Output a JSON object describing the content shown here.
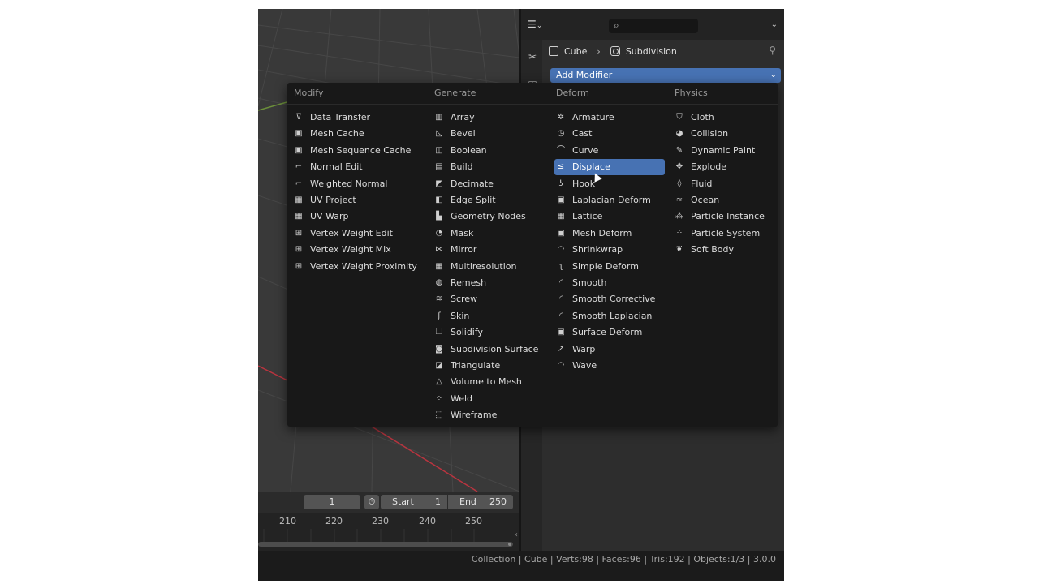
{
  "breadcrumb": {
    "object": "Cube",
    "modifier": "Subdivision"
  },
  "add_modifier": {
    "label": "Add Modifier"
  },
  "menu": {
    "columns": [
      {
        "title": "Modify",
        "items": [
          {
            "label": "Data Transfer",
            "icon": "data-transfer-icon",
            "glyph": "⊽"
          },
          {
            "label": "Mesh Cache",
            "icon": "mesh-cache-icon",
            "glyph": "▣"
          },
          {
            "label": "Mesh Sequence Cache",
            "icon": "mesh-sequence-cache-icon",
            "glyph": "▣"
          },
          {
            "label": "Normal Edit",
            "icon": "normal-edit-icon",
            "glyph": "⌐"
          },
          {
            "label": "Weighted Normal",
            "icon": "weighted-normal-icon",
            "glyph": "⌐"
          },
          {
            "label": "UV Project",
            "icon": "uv-project-icon",
            "glyph": "▦"
          },
          {
            "label": "UV Warp",
            "icon": "uv-warp-icon",
            "glyph": "▦"
          },
          {
            "label": "Vertex Weight Edit",
            "icon": "vertex-weight-edit-icon",
            "glyph": "⊞"
          },
          {
            "label": "Vertex Weight Mix",
            "icon": "vertex-weight-mix-icon",
            "glyph": "⊞"
          },
          {
            "label": "Vertex Weight Proximity",
            "icon": "vertex-weight-proximity-icon",
            "glyph": "⊞"
          }
        ]
      },
      {
        "title": "Generate",
        "items": [
          {
            "label": "Array",
            "icon": "array-icon",
            "glyph": "▥"
          },
          {
            "label": "Bevel",
            "icon": "bevel-icon",
            "glyph": "◺"
          },
          {
            "label": "Boolean",
            "icon": "boolean-icon",
            "glyph": "◫"
          },
          {
            "label": "Build",
            "icon": "build-icon",
            "glyph": "▤"
          },
          {
            "label": "Decimate",
            "icon": "decimate-icon",
            "glyph": "◩"
          },
          {
            "label": "Edge Split",
            "icon": "edge-split-icon",
            "glyph": "◧"
          },
          {
            "label": "Geometry Nodes",
            "icon": "geometry-nodes-icon",
            "glyph": "▙"
          },
          {
            "label": "Mask",
            "icon": "mask-icon",
            "glyph": "◔"
          },
          {
            "label": "Mirror",
            "icon": "mirror-icon",
            "glyph": "⋈"
          },
          {
            "label": "Multiresolution",
            "icon": "multiresolution-icon",
            "glyph": "▦"
          },
          {
            "label": "Remesh",
            "icon": "remesh-icon",
            "glyph": "◍"
          },
          {
            "label": "Screw",
            "icon": "screw-icon",
            "glyph": "≋"
          },
          {
            "label": "Skin",
            "icon": "skin-icon",
            "glyph": "ʃ"
          },
          {
            "label": "Solidify",
            "icon": "solidify-icon",
            "glyph": "❒"
          },
          {
            "label": "Subdivision Surface",
            "icon": "subdivision-surface-icon",
            "glyph": "◙"
          },
          {
            "label": "Triangulate",
            "icon": "triangulate-icon",
            "glyph": "◪"
          },
          {
            "label": "Volume to Mesh",
            "icon": "volume-to-mesh-icon",
            "glyph": "△"
          },
          {
            "label": "Weld",
            "icon": "weld-icon",
            "glyph": "⁘"
          },
          {
            "label": "Wireframe",
            "icon": "wireframe-icon",
            "glyph": "⬚"
          }
        ]
      },
      {
        "title": "Deform",
        "items": [
          {
            "label": "Armature",
            "icon": "armature-icon",
            "glyph": "✲"
          },
          {
            "label": "Cast",
            "icon": "cast-icon",
            "glyph": "◷"
          },
          {
            "label": "Curve",
            "icon": "curve-icon",
            "glyph": "⌒"
          },
          {
            "label": "Displace",
            "icon": "displace-icon",
            "glyph": "≤"
          },
          {
            "label": "Hook",
            "icon": "hook-icon",
            "glyph": "ʖ"
          },
          {
            "label": "Laplacian Deform",
            "icon": "laplacian-deform-icon",
            "glyph": "▣"
          },
          {
            "label": "Lattice",
            "icon": "lattice-icon",
            "glyph": "▦"
          },
          {
            "label": "Mesh Deform",
            "icon": "mesh-deform-icon",
            "glyph": "▣"
          },
          {
            "label": "Shrinkwrap",
            "icon": "shrinkwrap-icon",
            "glyph": "◠"
          },
          {
            "label": "Simple Deform",
            "icon": "simple-deform-icon",
            "glyph": "ʅ"
          },
          {
            "label": "Smooth",
            "icon": "smooth-icon",
            "glyph": "◜"
          },
          {
            "label": "Smooth Corrective",
            "icon": "smooth-corrective-icon",
            "glyph": "◜"
          },
          {
            "label": "Smooth Laplacian",
            "icon": "smooth-laplacian-icon",
            "glyph": "◜"
          },
          {
            "label": "Surface Deform",
            "icon": "surface-deform-icon",
            "glyph": "▣"
          },
          {
            "label": "Warp",
            "icon": "warp-icon",
            "glyph": "↗"
          },
          {
            "label": "Wave",
            "icon": "wave-icon",
            "glyph": "◠"
          }
        ]
      },
      {
        "title": "Physics",
        "items": [
          {
            "label": "Cloth",
            "icon": "cloth-icon",
            "glyph": "⛉"
          },
          {
            "label": "Collision",
            "icon": "collision-icon",
            "glyph": "◕"
          },
          {
            "label": "Dynamic Paint",
            "icon": "dynamic-paint-icon",
            "glyph": "✎"
          },
          {
            "label": "Explode",
            "icon": "explode-icon",
            "glyph": "✥"
          },
          {
            "label": "Fluid",
            "icon": "fluid-icon",
            "glyph": "◊"
          },
          {
            "label": "Ocean",
            "icon": "ocean-icon",
            "glyph": "≈"
          },
          {
            "label": "Particle Instance",
            "icon": "particle-instance-icon",
            "glyph": "⁂"
          },
          {
            "label": "Particle System",
            "icon": "particle-system-icon",
            "glyph": "⁘"
          },
          {
            "label": "Soft Body",
            "icon": "soft-body-icon",
            "glyph": "❦"
          }
        ]
      }
    ],
    "active": "Displace"
  },
  "timeline": {
    "current_frame": "1",
    "start_label": "Start",
    "start_value": "1",
    "end_label": "End",
    "end_value": "250",
    "ticks": [
      "210",
      "220",
      "230",
      "240",
      "250"
    ]
  },
  "status": {
    "text": "Collection | Cube | Verts:98 | Faces:96 | Tris:192 | Objects:1/3 | 3.0.0"
  },
  "colors": {
    "accent": "#4772b3",
    "menu_bg": "#181818",
    "panel_bg": "#2d2d2d"
  }
}
